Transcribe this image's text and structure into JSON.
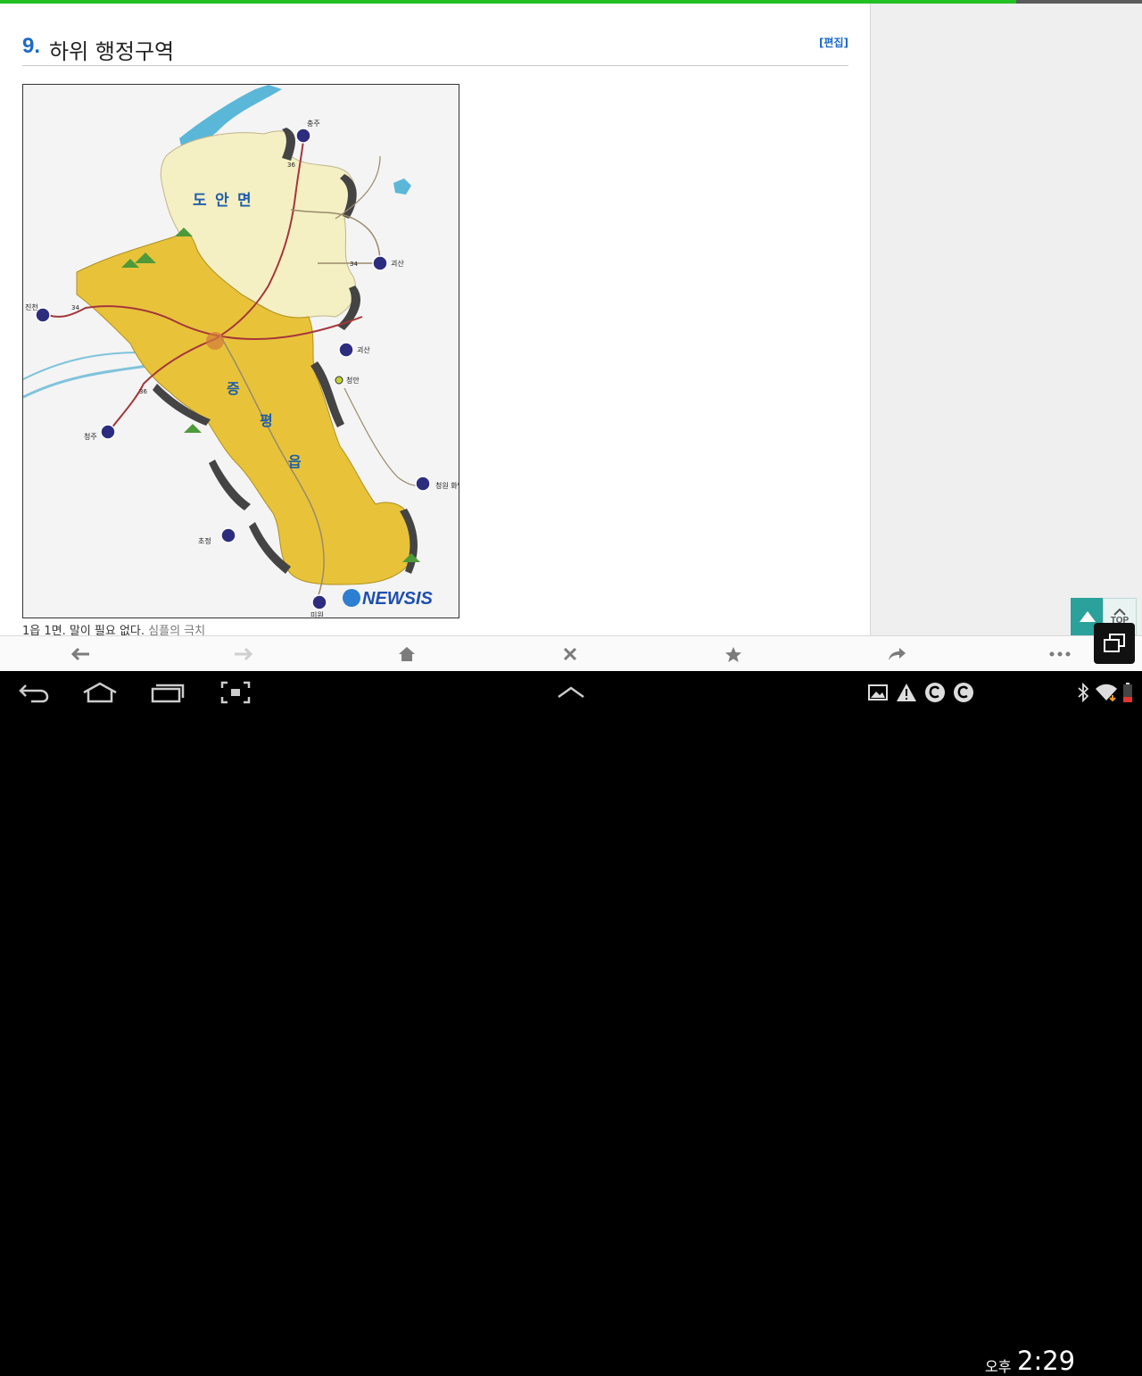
{
  "browser": {
    "load_progress_percent": 89,
    "toolbar": {
      "back_icon": "arrow-left-icon",
      "forward_icon": "arrow-right-icon",
      "home_icon": "home-icon",
      "close_icon": "close-icon",
      "bookmark_icon": "star-icon",
      "share_icon": "share-icon",
      "more_icon": "more-icon"
    },
    "floating": {
      "top_label": "TOP"
    }
  },
  "article": {
    "section_number": "9.",
    "section_title": "하위 행정구역",
    "edit_link": "[편집]",
    "caption_main": "1읍 1면. 말이 필요 없다.",
    "caption_muted": "심플의 극치"
  },
  "map": {
    "region_labels": [
      "도",
      "안",
      "면",
      "증",
      "평",
      "읍"
    ],
    "routes": [
      {
        "label": "충주"
      },
      {
        "label": "괴산"
      },
      {
        "label": "괴산"
      },
      {
        "label": "진천"
      },
      {
        "label": "청주"
      },
      {
        "label": "청원\n화양동"
      },
      {
        "label": "초정"
      },
      {
        "label": "미원"
      }
    ],
    "place_labels": [
      "청안",
      "36",
      "34",
      "34",
      "36"
    ],
    "watermark": "NEWSIS",
    "colors": {
      "south_region": "#e8c33a",
      "north_region": "#f5efc4",
      "water": "#5ab7d8",
      "road": "#a4373a"
    }
  },
  "statusbar": {
    "ampm": "오후",
    "time": "2:29"
  },
  "colors": {
    "accent_blue": "#1b6ac9",
    "progress_green": "#22c022",
    "float_teal": "#2ba19b"
  }
}
